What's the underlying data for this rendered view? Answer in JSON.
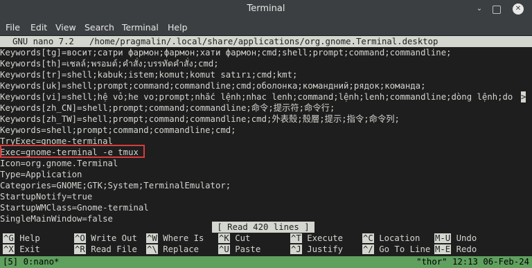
{
  "window": {
    "title": "Terminal",
    "menu": [
      "File",
      "Edit",
      "View",
      "Search",
      "Terminal",
      "Help"
    ]
  },
  "nano": {
    "version": "GNU nano 7.2",
    "path": "/home/pragmalin/.local/share/applications/org.gnome.Terminal.desktop",
    "lines": [
      "Keywords[tg]=восит;сатри фармон;фармон;хати фармон;cmd;shell;prompt;command;commandline;",
      "Keywords[th]=เชลล์;พรอมต์;คำสั่ง;บรรทัดคำสั่ง;cmd;",
      "Keywords[tr]=shell;kabuk;istem;komut;komut satırı;cmd;kmt;",
      "Keywords[uk]=shell;prompt;command;commandline;cmd;оболонка;командний;рядок;команда;",
      "Keywords[vi]=shell;hệ vỏ;he vo;prompt;nhắc lệnh;nhac lenh;command;lệnh;lenh;commandline;dòng lệnh;do",
      "Keywords[zh_CN]=shell;prompt;command;commandline;命令;提示符;命令行;",
      "Keywords[zh_TW]=shell;prompt;command;commandline;cmd;外表殼;殼層;提示;指令;命令列;",
      "Keywords=shell;prompt;command;commandline;cmd;",
      "TryExec=gnome-terminal",
      "Exec=gnome-terminal -e tmux",
      "Icon=org.gnome.Terminal",
      "Type=Application",
      "Categories=GNOME;GTK;System;TerminalEmulator;",
      "StartupNotify=true",
      "StartupWMClass=Gnome-terminal",
      "SingleMainWindow=false"
    ],
    "overflow_marker": ">",
    "status_message": "[ Read 420 lines ]",
    "shortcuts_row1": [
      {
        "key": "^G",
        "label": "Help"
      },
      {
        "key": "^O",
        "label": "Write Out"
      },
      {
        "key": "^W",
        "label": "Where Is"
      },
      {
        "key": "^K",
        "label": "Cut"
      },
      {
        "key": "^T",
        "label": "Execute"
      },
      {
        "key": "^C",
        "label": "Location"
      },
      {
        "key": "M-U",
        "label": "Undo"
      }
    ],
    "shortcuts_row2": [
      {
        "key": "^X",
        "label": "Exit"
      },
      {
        "key": "^R",
        "label": "Read File"
      },
      {
        "key": "^\\",
        "label": "Replace"
      },
      {
        "key": "^U",
        "label": "Paste"
      },
      {
        "key": "^J",
        "label": "Justify"
      },
      {
        "key": "^/",
        "label": "Go To Line"
      },
      {
        "key": "M-E",
        "label": "Redo"
      }
    ]
  },
  "tmux": {
    "left": "[5] 0:nano*",
    "right": "\"thor\" 12:13 06-Feb-24"
  },
  "colors": {
    "highlight_box": "#d93c3c",
    "tmux_bar": "#5fa05f"
  }
}
